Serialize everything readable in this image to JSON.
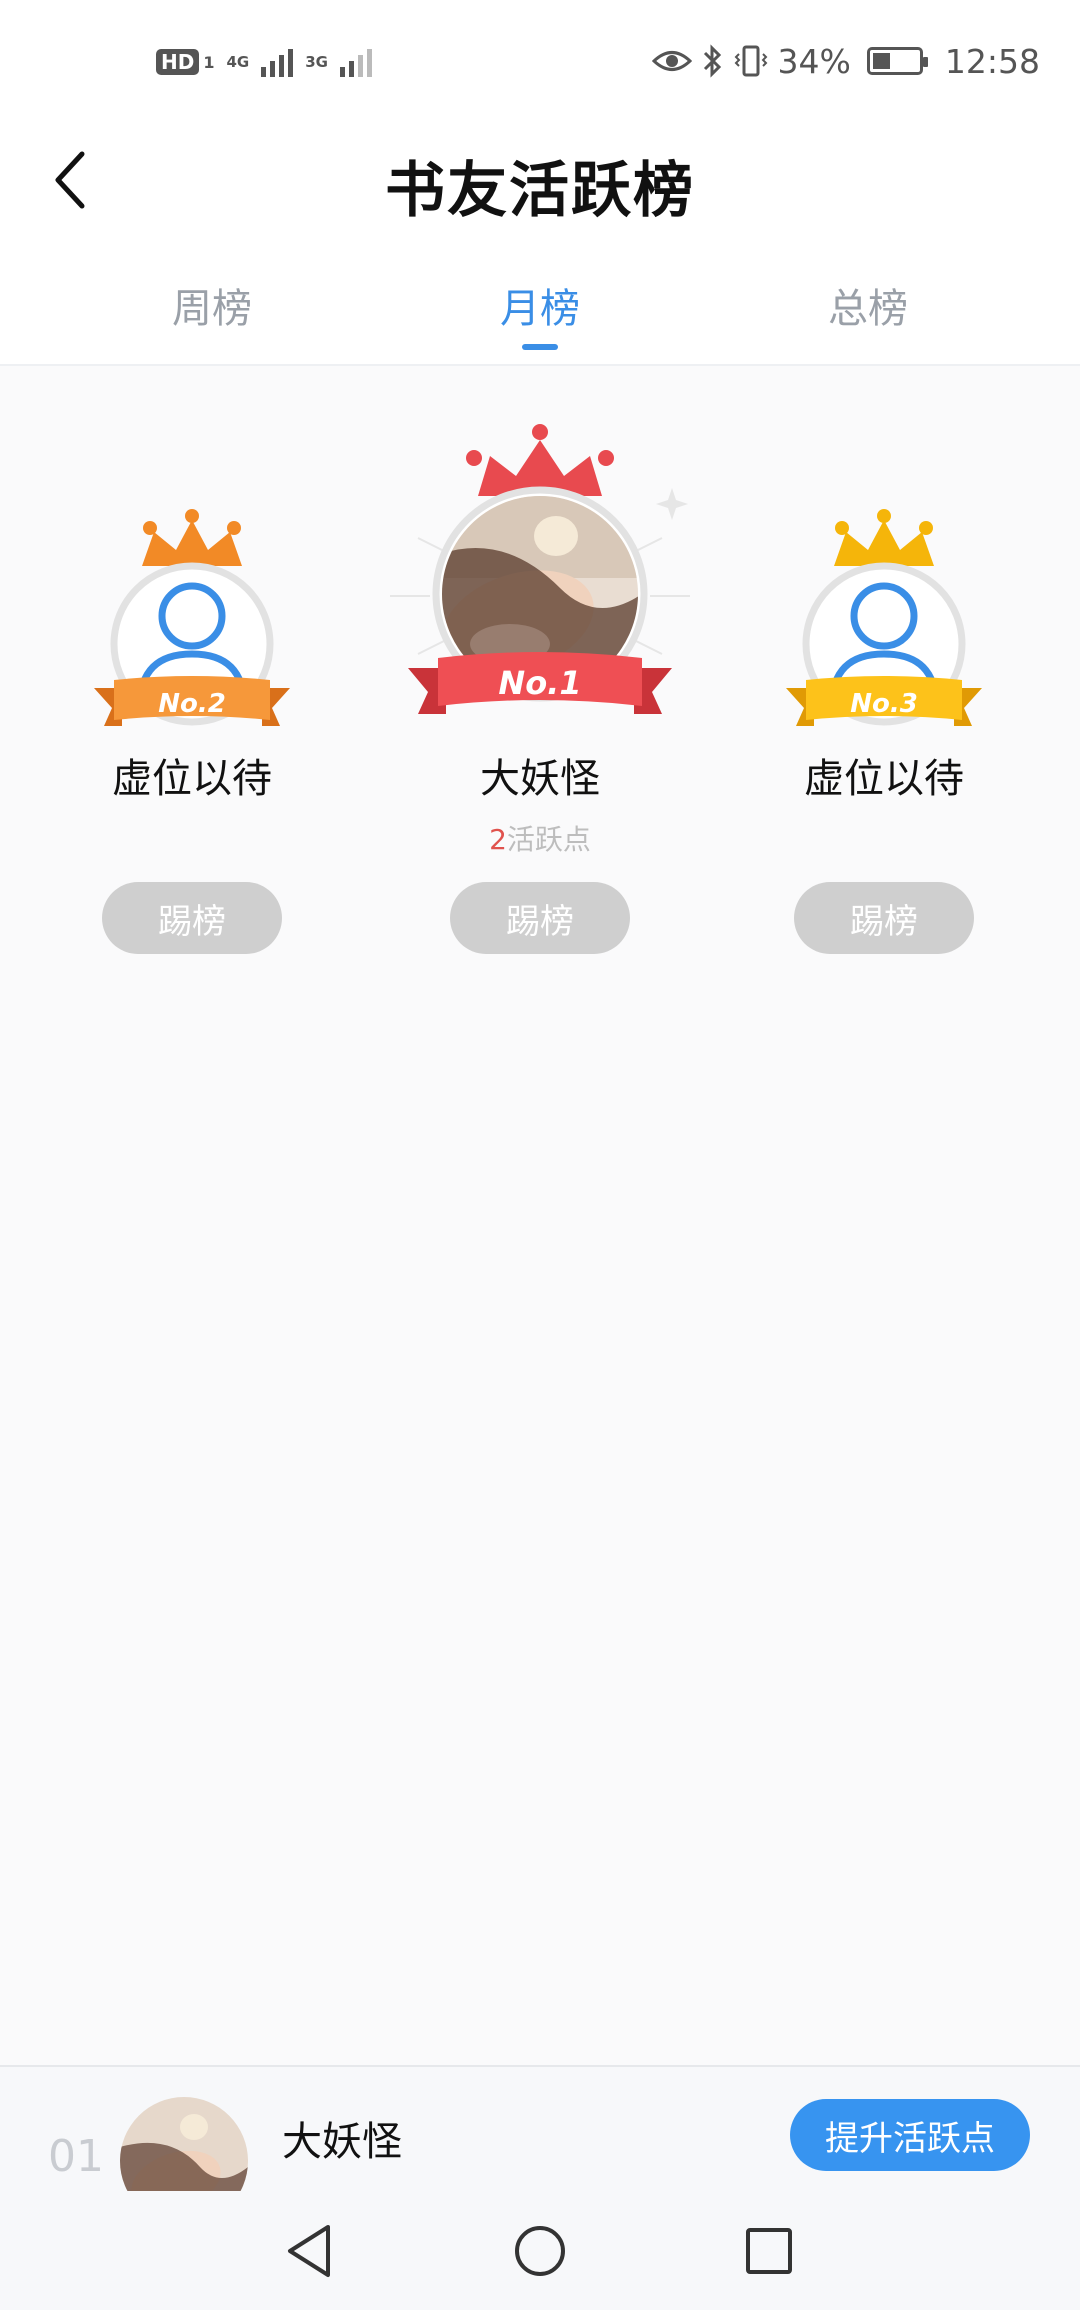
{
  "status_bar": {
    "hd": "HD",
    "sim": "1",
    "net1": "4G",
    "net2": "3G",
    "battery_text": "34%",
    "battery_level": 0.34,
    "time": "12:58",
    "icons": [
      "eye-icon",
      "bluetooth-icon",
      "vibrate-icon",
      "battery-icon"
    ]
  },
  "header": {
    "title": "书友活跃榜",
    "back_icon": "chevron-left-icon"
  },
  "tabs": [
    {
      "label": "周榜",
      "active": false
    },
    {
      "label": "月榜",
      "active": true
    },
    {
      "label": "总榜",
      "active": false
    }
  ],
  "podium": {
    "first": {
      "rank": "No.1",
      "name": "大妖怪",
      "points_num": "2",
      "points_label": "活跃点",
      "kick": "踢榜"
    },
    "second": {
      "rank": "No.2",
      "name": "虚位以待",
      "kick": "踢榜"
    },
    "third": {
      "rank": "No.3",
      "name": "虚位以待",
      "kick": "踢榜"
    }
  },
  "self_bar": {
    "rank": "01",
    "name": "大妖怪",
    "boost": "提升活跃点"
  },
  "colors": {
    "accent": "#3a8ee6",
    "gold": "#f5b50a",
    "orange": "#f28a26",
    "red": "#e84a4f"
  }
}
